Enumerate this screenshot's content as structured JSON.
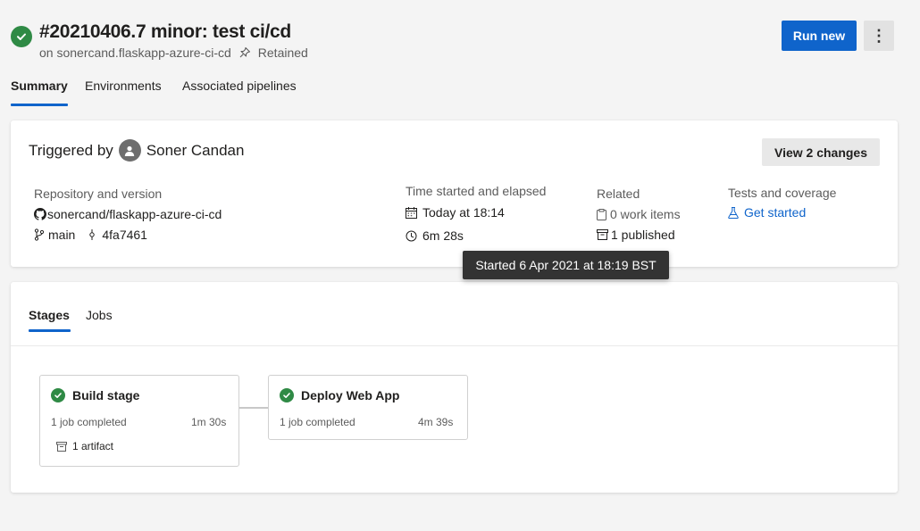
{
  "header": {
    "title": "#20210406.7 minor: test ci/cd",
    "subtitle_repo": "on sonercand.flaskapp-azure-ci-cd",
    "retained_label": "Retained",
    "run_new_label": "Run new",
    "more_label": "⋮"
  },
  "tabs": [
    {
      "label": "Summary",
      "active": true
    },
    {
      "label": "Environments",
      "active": false
    },
    {
      "label": "Associated pipelines",
      "active": false
    }
  ],
  "summary": {
    "triggered_by_label": "Triggered by",
    "user_name": "Soner Candan",
    "view_changes_label": "View 2 changes",
    "repo_heading": "Repository and version",
    "repo_name": "sonercand/flaskapp-azure-ci-cd",
    "branch": "main",
    "commit": "4fa7461",
    "time_heading": "Time started and elapsed",
    "time_started": "Today at 18:14",
    "elapsed": "6m 28s",
    "related_heading": "Related",
    "work_items": "0 work items",
    "published": "1 published",
    "tests_heading": "Tests and coverage",
    "tests_link": "Get started",
    "tooltip": "Started 6 Apr 2021 at 18:19 BST"
  },
  "stages_tabs": [
    {
      "label": "Stages",
      "active": true
    },
    {
      "label": "Jobs",
      "active": false
    }
  ],
  "stages": [
    {
      "name": "Build stage",
      "jobs": "1 job completed",
      "duration": "1m 30s",
      "artifact": "1 artifact"
    },
    {
      "name": "Deploy Web App",
      "jobs": "1 job completed",
      "duration": "4m 39s"
    }
  ],
  "colors": {
    "success": "#2f8a45",
    "accent": "#0f64cb"
  }
}
